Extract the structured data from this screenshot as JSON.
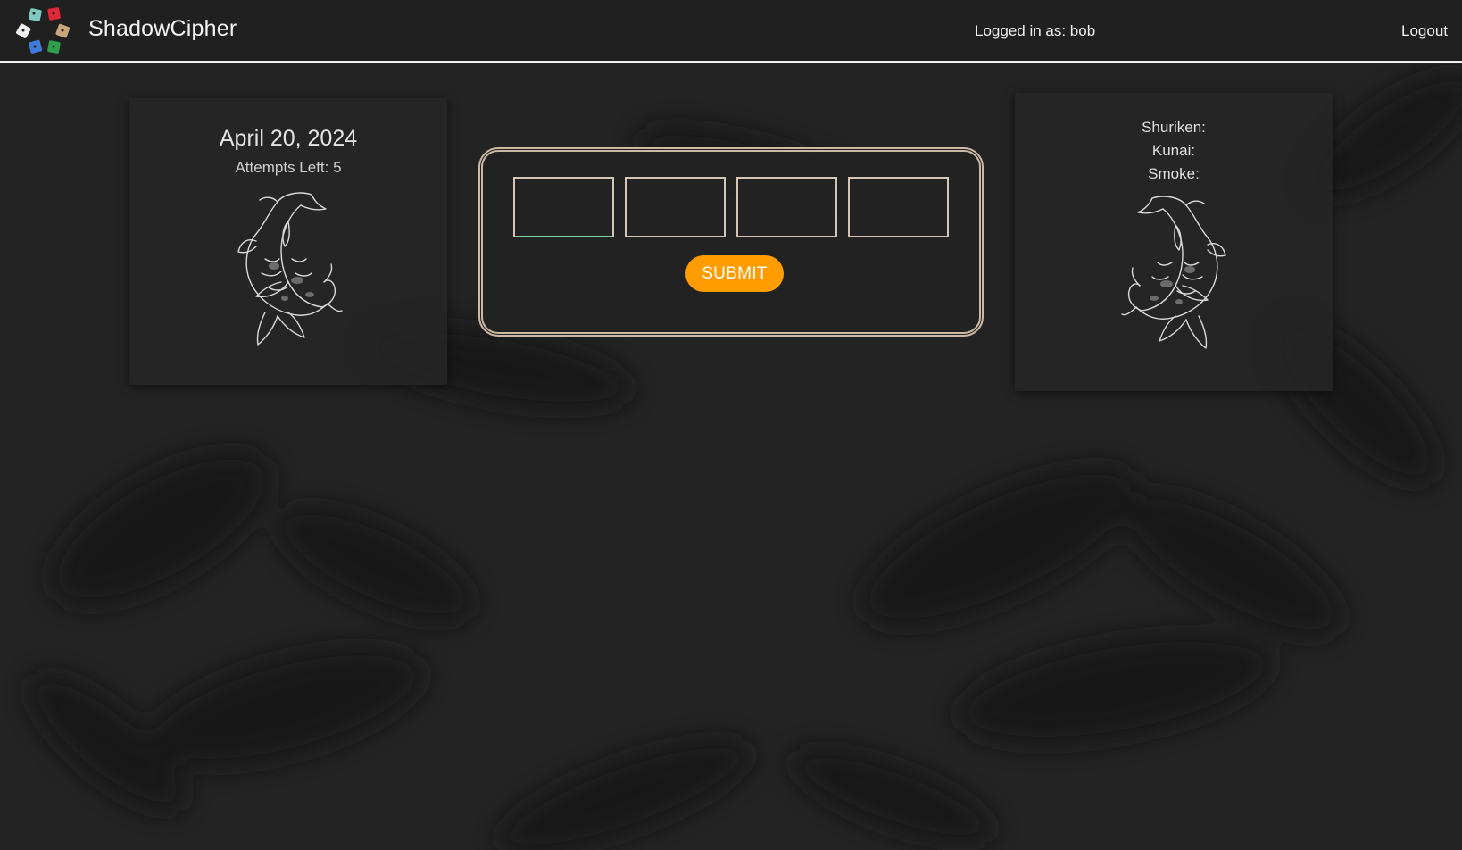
{
  "header": {
    "brand": "ShadowCipher",
    "user_text": "Logged in as: bob",
    "logout_label": "Logout"
  },
  "left_card": {
    "date": "April 20, 2024",
    "attempts": "Attempts Left: 5"
  },
  "right_card": {
    "items": [
      "Shuriken:",
      "Kunai:",
      "Smoke:"
    ]
  },
  "game": {
    "inputs": [
      "",
      "",
      "",
      ""
    ],
    "submit_label": "SUBMIT"
  },
  "colors": {
    "background": "#232323",
    "header": "#202020",
    "accent": "#ff9d00",
    "panel_border": "#cbb9a6",
    "logo_teal": "#7ec9c0",
    "logo_red": "#e2263a",
    "logo_white": "#f0f0f0",
    "logo_tan": "#c9a67b",
    "logo_blue": "#3f7bd8",
    "logo_green": "#2f9e4c"
  },
  "icons": {
    "logo": "dice-cluster-icon",
    "koi": "koi-fish-icon"
  }
}
